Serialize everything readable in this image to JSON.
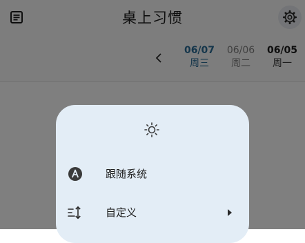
{
  "header": {
    "title": "桌上习惯",
    "menu_icon": "list-icon",
    "settings_icon": "gear-icon"
  },
  "date_bar": {
    "prev_icon": "chevron-left-icon",
    "days": [
      {
        "date": "06/07",
        "weekday": "周三",
        "selected": true
      },
      {
        "date": "06/06",
        "weekday": "周二",
        "selected": false
      },
      {
        "date": "06/05",
        "weekday": "周一",
        "selected": false
      }
    ]
  },
  "dialog": {
    "icon": "sun-icon",
    "options": [
      {
        "label": "跟随系统",
        "icon": "circle-a-icon"
      },
      {
        "label": "自定义",
        "icon": "sort-icon",
        "trailing_icon": "caret-right-icon"
      }
    ]
  },
  "colors": {
    "accent": "#2b6d97",
    "dialog_bg": "#e3edf6",
    "scrim": "rgba(0,0,0,0.5)"
  }
}
